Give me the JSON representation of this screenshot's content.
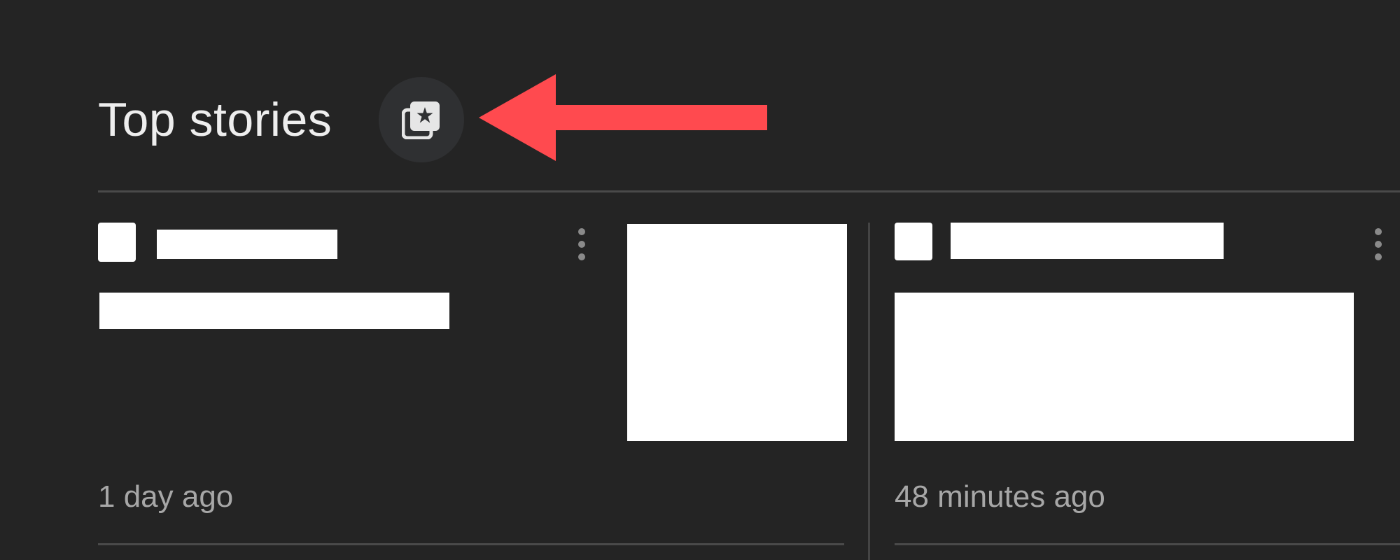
{
  "header": {
    "title": "Top stories"
  },
  "icons": {
    "stack_button": "stacked-cards-star-icon",
    "annotation": "red-left-arrow-icon",
    "more": "more-vert-icon"
  },
  "colors": {
    "background": "#242424",
    "title_text": "#eeeeee",
    "timestamp_text": "#a7a7a7",
    "arrow": "#ff4a4f",
    "button_bg": "#2f3032"
  },
  "stories": [
    {
      "time": "1 day ago"
    },
    {
      "time": "48 minutes ago"
    }
  ]
}
